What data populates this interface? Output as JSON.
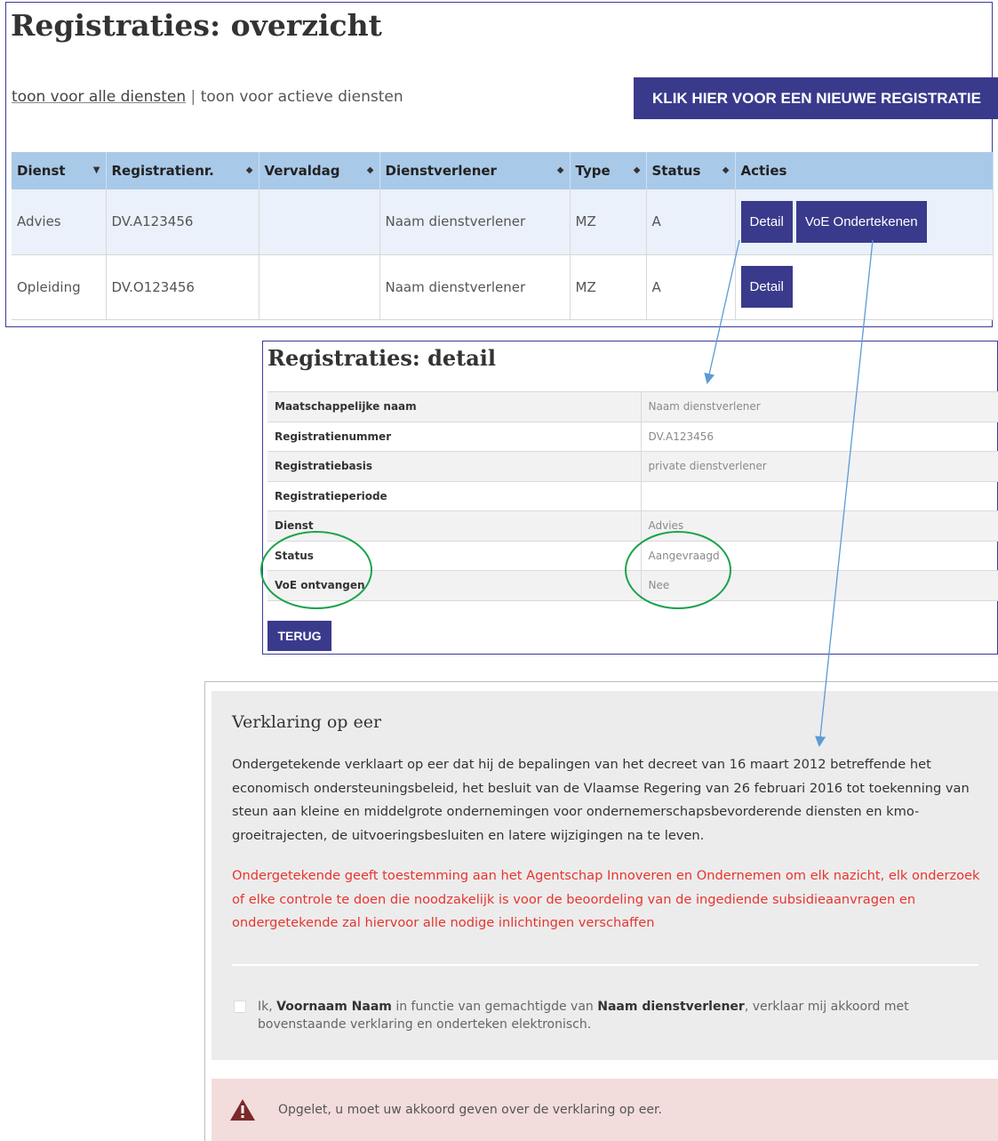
{
  "overview": {
    "title": "Registraties: overzicht",
    "filter_all": "toon voor alle diensten",
    "filter_sep": "|",
    "filter_active": "toon voor actieve diensten",
    "new_registration_button": "KLIK HIER VOOR EEN NIEUWE REGISTRATIE",
    "columns": [
      "Dienst",
      "Registratienr.",
      "Vervaldag",
      "Dienstverlener",
      "Type",
      "Status",
      "Acties"
    ],
    "rows": [
      {
        "dienst": "Advies",
        "registratienr": "DV.A123456",
        "vervaldag": "",
        "dienstverlener": "Naam dienstverlener",
        "type": "MZ",
        "status": "A",
        "actions": [
          "Detail",
          "VoE Ondertekenen"
        ]
      },
      {
        "dienst": "Opleiding",
        "registratienr": "DV.O123456",
        "vervaldag": "",
        "dienstverlener": "Naam dienstverlener",
        "type": "MZ",
        "status": "A",
        "actions": [
          "Detail"
        ]
      }
    ]
  },
  "detail": {
    "title": "Registraties: detail",
    "fields": [
      {
        "label": "Maatschappelijke naam",
        "value": "Naam dienstverlener"
      },
      {
        "label": "Registratienummer",
        "value": "DV.A123456"
      },
      {
        "label": "Registratiebasis",
        "value": "private dienstverlener"
      },
      {
        "label": "Registratieperiode",
        "value": ""
      },
      {
        "label": "Dienst",
        "value": "Advies"
      },
      {
        "label": "Status",
        "value": "Aangevraagd"
      },
      {
        "label": "VoE ontvangen",
        "value": "Nee"
      }
    ],
    "back_button": "TERUG"
  },
  "declaration": {
    "heading": "Verklaring op eer",
    "paragraph_main": "Ondergetekende verklaart op eer dat hij de bepalingen van het decreet van 16 maart 2012 betreffende het economisch ondersteuningsbeleid, het besluit van de Vlaamse Regering van 26 februari 2016 tot toekenning van steun aan kleine en middelgrote ondernemingen voor ondernemerschapsbevorderende diensten en kmo-groeitrajecten, de uitvoeringsbesluiten en latere wijzigingen na te leven.",
    "paragraph_warning": "Ondergetekende geeft toestemming aan het Agentschap Innoveren en Ondernemen om elk nazicht, elk onderzoek of elke controle te doen die noodzakelijk is voor de beoordeling van de ingediende subsidieaanvragen en ondergetekende zal hiervoor alle nodige inlichtingen verschaffen",
    "agree_prefix": "Ik,",
    "agree_name": "Voornaam Naam",
    "agree_middle": "in functie van gemachtigde van",
    "agree_company": "Naam dienstverlener",
    "agree_suffix": ", verklaar mij akkoord met bovenstaande verklaring en onderteken elektronisch.",
    "agree_checked": false,
    "alert_icon": "warning-triangle-icon",
    "alert_text": "Opgelet, u moet uw akkoord geven over de verklaring op eer."
  },
  "colors": {
    "button_bg": "#3a3a8c",
    "table_header_bg": "#a9c9e9",
    "row_highlight_bg": "#eaf1fa",
    "warning_text": "#e8342f",
    "alert_bg": "#f3dcdc",
    "annotation_arrow": "#5b9bd5",
    "annotation_ellipse": "#1aa34a"
  }
}
